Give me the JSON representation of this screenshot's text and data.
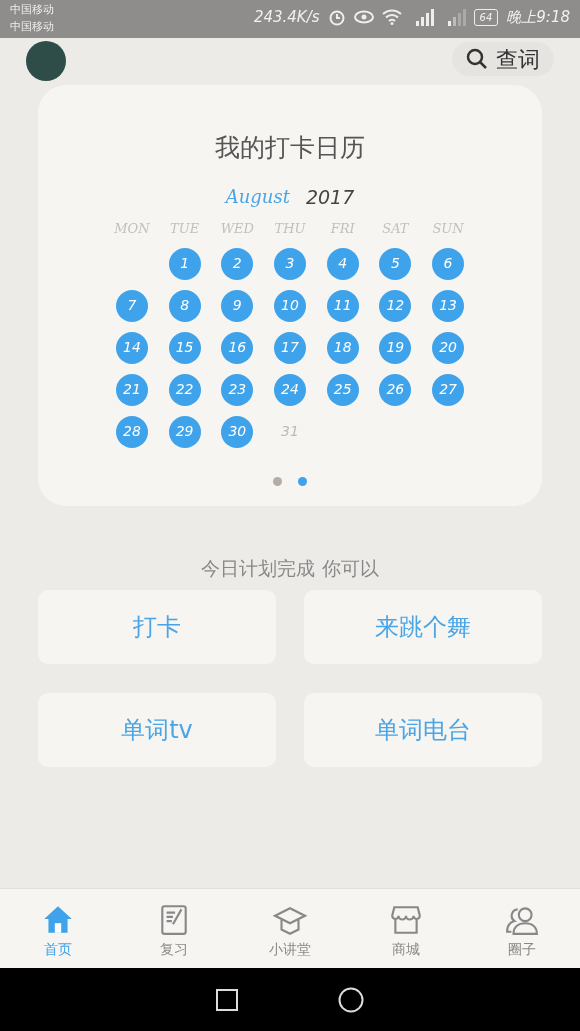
{
  "status_bar": {
    "carriers": [
      "中国移动",
      "中国移动"
    ],
    "speed": "243.4K/s",
    "battery": "64",
    "time": "晚上9:18"
  },
  "search_button": {
    "label": "查词"
  },
  "calendar": {
    "title": "我的打卡日历",
    "month": "August",
    "year": "2017",
    "weekdays": [
      "MON",
      "TUE",
      "WED",
      "THU",
      "FRI",
      "SAT",
      "SUN"
    ],
    "weeks": [
      [
        {
          "day": "1",
          "checked": true
        },
        {
          "day": "2",
          "checked": true
        },
        {
          "day": "3",
          "checked": true
        },
        {
          "day": "4",
          "checked": true
        },
        {
          "day": "5",
          "checked": true
        },
        {
          "day": "6",
          "checked": true
        }
      ],
      [
        {
          "day": "7",
          "checked": true
        },
        {
          "day": "8",
          "checked": true
        },
        {
          "day": "9",
          "checked": true
        },
        {
          "day": "10",
          "checked": true
        },
        {
          "day": "11",
          "checked": true
        },
        {
          "day": "12",
          "checked": true
        },
        {
          "day": "13",
          "checked": true
        }
      ],
      [
        {
          "day": "14",
          "checked": true
        },
        {
          "day": "15",
          "checked": true
        },
        {
          "day": "16",
          "checked": true
        },
        {
          "day": "17",
          "checked": true
        },
        {
          "day": "18",
          "checked": true
        },
        {
          "day": "19",
          "checked": true
        },
        {
          "day": "20",
          "checked": true
        }
      ],
      [
        {
          "day": "21",
          "checked": true
        },
        {
          "day": "22",
          "checked": true
        },
        {
          "day": "23",
          "checked": true
        },
        {
          "day": "24",
          "checked": true
        },
        {
          "day": "25",
          "checked": true
        },
        {
          "day": "26",
          "checked": true
        },
        {
          "day": "27",
          "checked": true
        }
      ],
      [
        {
          "day": "28",
          "checked": true
        },
        {
          "day": "29",
          "checked": true
        },
        {
          "day": "30",
          "checked": true
        },
        {
          "day": "31",
          "checked": false
        }
      ]
    ],
    "pages": [
      {
        "selected": false
      },
      {
        "selected": true
      }
    ]
  },
  "prompt": "今日计划完成 你可以",
  "actions": [
    "打卡",
    "来跳个舞",
    "单词tv",
    "单词电台"
  ],
  "tabs": [
    {
      "label": "首页",
      "kind": "home",
      "selected": true
    },
    {
      "label": "复习",
      "kind": "review",
      "selected": false
    },
    {
      "label": "小讲堂",
      "kind": "lesson",
      "selected": false
    },
    {
      "label": "商城",
      "kind": "shop",
      "selected": false
    },
    {
      "label": "圈子",
      "kind": "friends",
      "selected": false
    }
  ]
}
